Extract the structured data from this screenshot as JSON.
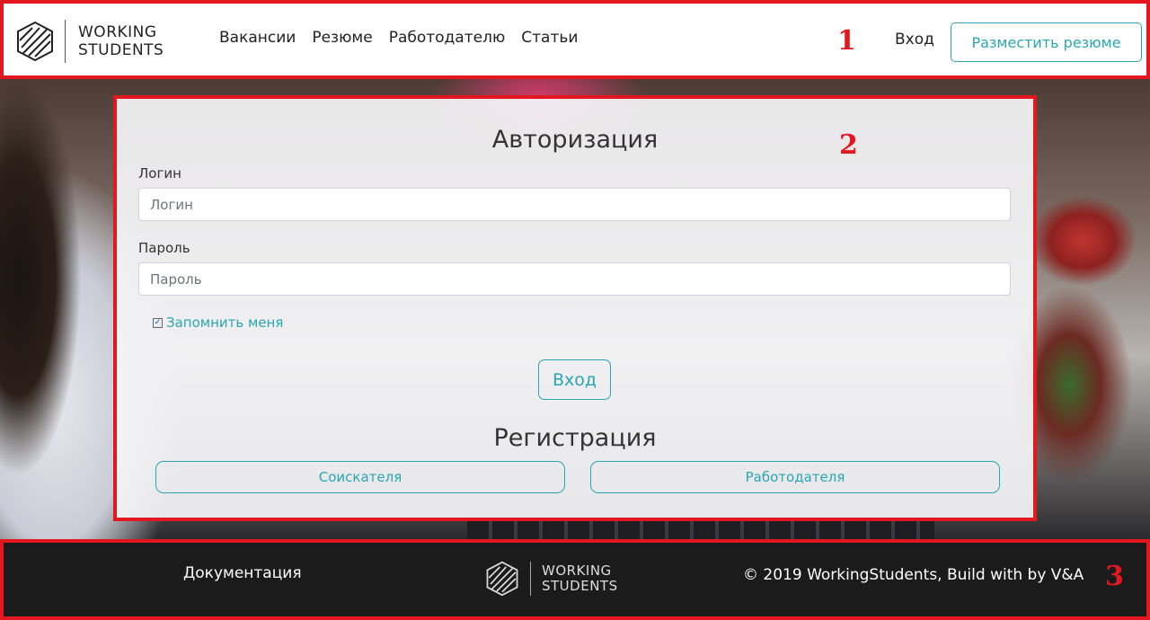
{
  "header": {
    "logo_line1": "WORKING",
    "logo_line2": "STUDENTS",
    "nav": [
      "Вакансии",
      "Резюме",
      "Работодателю",
      "Статьи"
    ],
    "annotation": "1",
    "login_link": "Вход",
    "post_resume_button": "Разместить резюме"
  },
  "auth": {
    "annotation": "2",
    "title": "Авторизация",
    "login_label": "Логин",
    "login_placeholder": "Логин",
    "password_label": "Пароль",
    "password_placeholder": "Пароль",
    "remember_label": "Запомнить меня",
    "remember_checked": true,
    "login_button": "Вход",
    "register_title": "Регистрация",
    "register_buttons": [
      "Соискателя",
      "Работодателя"
    ]
  },
  "footer": {
    "annotation": "3",
    "docs_link": "Документация",
    "logo_line1": "WORKING",
    "logo_line2": "STUDENTS",
    "copyright": "© 2019 WorkingStudents, Build with by V&A"
  },
  "colors": {
    "accent": "#2aa6b3",
    "annotation_red": "#e3171f",
    "footer_bg": "#1c1b1c"
  }
}
